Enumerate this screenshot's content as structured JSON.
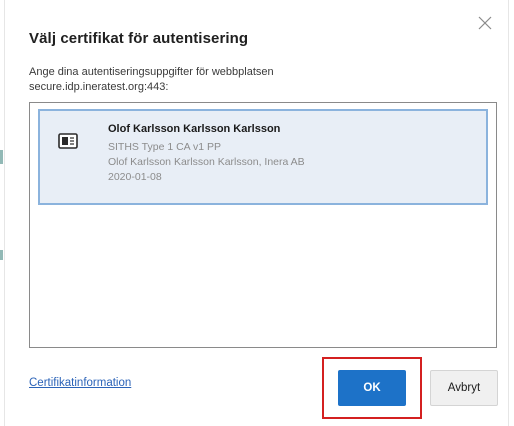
{
  "dialog": {
    "title": "Välj certifikat för autentisering",
    "description_line1": "Ange dina autentiseringsuppgifter för webbplatsen",
    "description_line2": "secure.idp.ineratest.org:443:",
    "close_icon": "close-icon"
  },
  "certificates": [
    {
      "name": "Olof Karlsson Karlsson Karlsson",
      "issuer": "SITHS Type 1 CA v1 PP",
      "subject": "Olof Karlsson Karlsson Karlsson, Inera AB",
      "date": "2020-01-08",
      "icon": "certificate-card-icon",
      "selected": true
    }
  ],
  "footer": {
    "cert_info_link": "Certifikatinformation",
    "ok_label": "OK",
    "cancel_label": "Avbryt"
  },
  "colors": {
    "primary_button": "#1d72c8",
    "selection_bg": "#e8eef6",
    "selection_border": "#8bb3dd",
    "highlight_box": "#d42020",
    "link": "#2b63b8"
  }
}
